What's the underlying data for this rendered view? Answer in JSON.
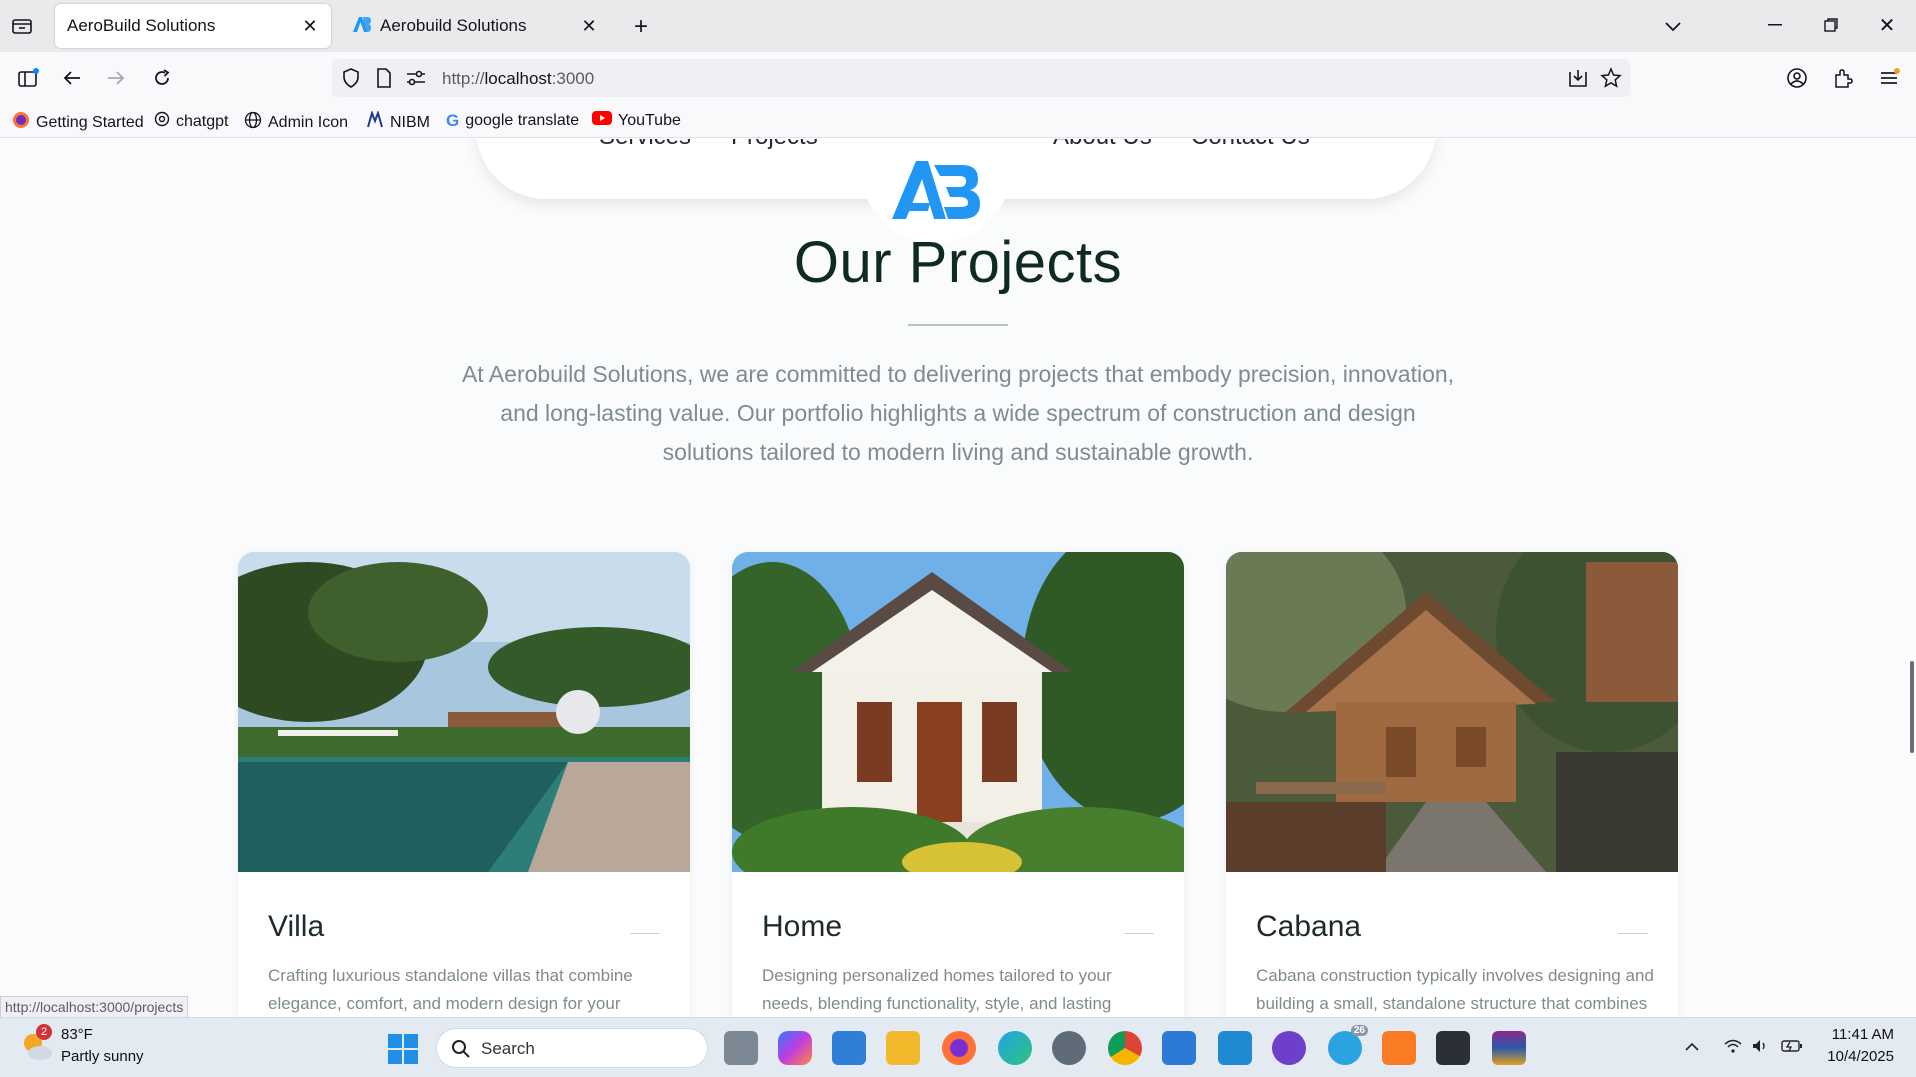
{
  "browser": {
    "tabs": [
      {
        "label": "AeroBuild Solutions",
        "active": true
      },
      {
        "label": "Aerobuild Solutions",
        "active": false
      }
    ],
    "url_prefix": "http://",
    "url_host": "localhost",
    "url_port": ":3000",
    "bookmarks": [
      {
        "label": "Getting Started",
        "icon": "firefox-icon"
      },
      {
        "label": "chatgpt",
        "icon": "chatgpt-icon"
      },
      {
        "label": "Admin Icon",
        "icon": "globe-icon"
      },
      {
        "label": "NIBM",
        "icon": "nibm-icon"
      },
      {
        "label": "google translate",
        "icon": "google-icon"
      },
      {
        "label": "YouTube",
        "icon": "youtube-icon"
      }
    ],
    "status_link": "http://localhost:3000/projects"
  },
  "nav": {
    "services": "Services",
    "projects": "Projects",
    "about": "About Us",
    "contact": "Contact Us",
    "logo_text": "AB",
    "brand_color": "#2196f3"
  },
  "section": {
    "title": "Our Projects",
    "intro": "At Aerobuild Solutions, we are committed to delivering projects that embody precision, innovation, and long-lasting value. Our portfolio highlights a wide spectrum of construction and design solutions tailored to modern living and sustainable growth."
  },
  "projects": [
    {
      "name": "Villa",
      "desc": "Crafting luxurious standalone villas that combine elegance, comfort, and modern design for your"
    },
    {
      "name": "Home",
      "desc": "Designing personalized homes tailored to your needs, blending functionality, style, and lasting"
    },
    {
      "name": "Cabana",
      "desc": "Cabana construction typically involves designing and building a small, standalone structure that combines"
    }
  ],
  "taskbar": {
    "weather_badge": "2",
    "temperature": "83°F",
    "weather": "Partly sunny",
    "search_label": "Search",
    "time": "11:41 AM",
    "date": "10/4/2025",
    "telegram_badge": "26"
  }
}
